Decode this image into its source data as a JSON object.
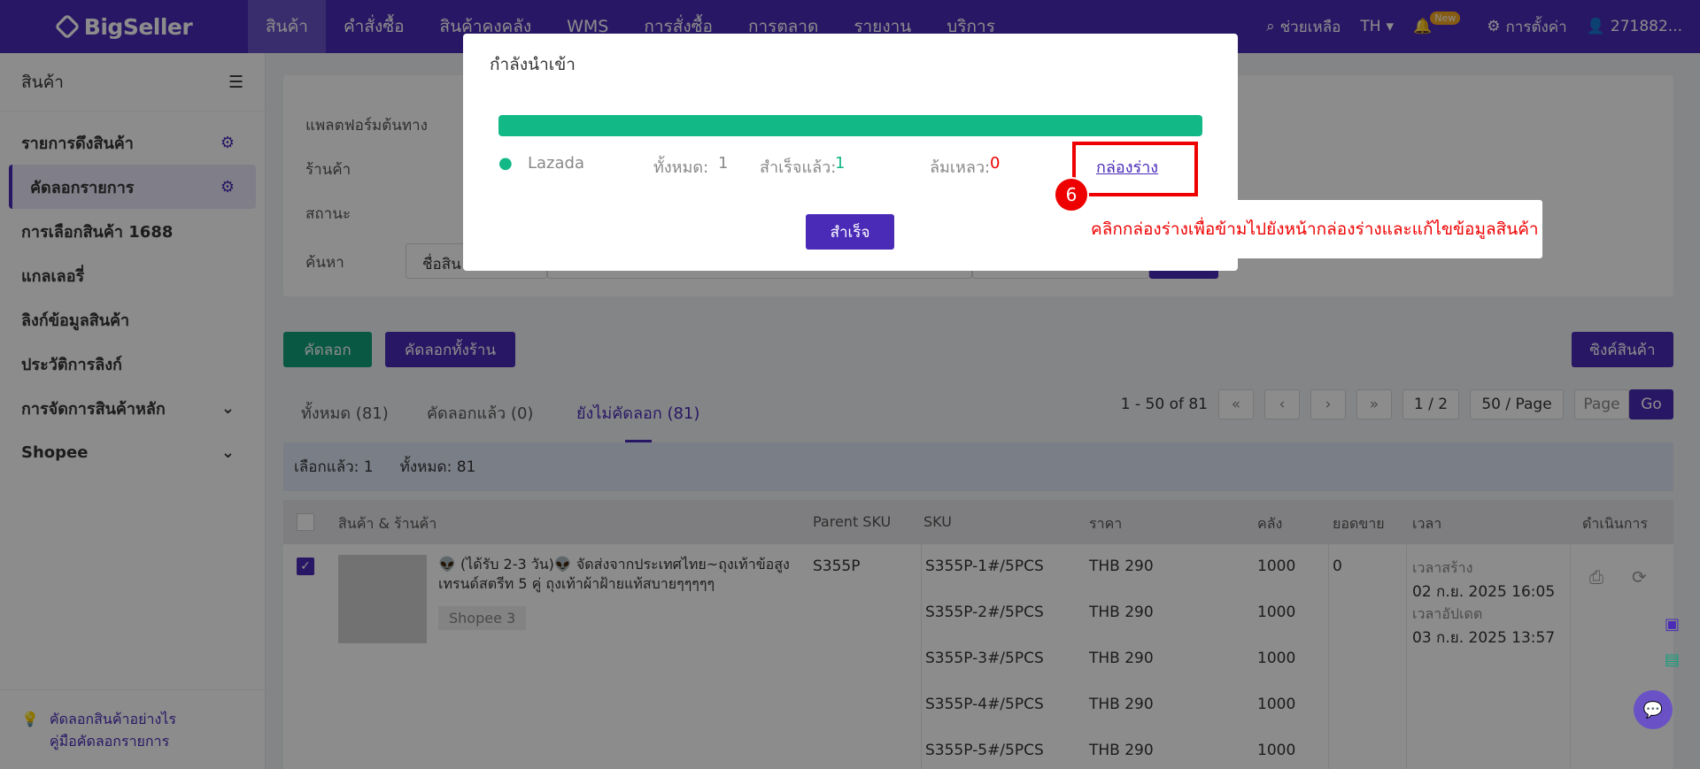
{
  "nav": {
    "logo": "BigSeller",
    "menu": [
      "สินค้า",
      "คำสั่งซื้อ",
      "สินค้าคงคลัง",
      "WMS",
      "การสั่งซื้อ",
      "การตลาด",
      "รายงาน",
      "บริการ"
    ],
    "help": "ช่วยเหลือ",
    "lang": "TH",
    "new_badge": "New",
    "settings": "การตั้งค่า",
    "user": "271882..."
  },
  "sidebar": {
    "title": "สินค้า",
    "items": [
      "รายการดึงสินค้า",
      "คัดลอกรายการ",
      "การเลือกสินค้า 1688",
      "แกลเลอรี่",
      "ลิงก์ข้อมูลสินค้า",
      "ประวัติการลิงก์",
      "การจัดการสินค้าหลัก",
      "Shopee"
    ],
    "footer_1": "คัดลอกสินค้าอย่างไร",
    "footer_2": "คู่มือคัดลอกรายการ"
  },
  "filter": {
    "platform_label": "แพลตฟอร์มต้นทาง",
    "store_label": "ร้านค้า",
    "status_label": "สถานะ",
    "search_label": "ค้นหา",
    "search_select": "ชื่อสิน"
  },
  "actions": {
    "copy": "คัดลอก",
    "copy_all": "คัดลอกทั้งร้าน",
    "sync": "ซิงค์สินค้า"
  },
  "tabs": [
    "ทั้งหมด (81)",
    "คัดลอกแล้ว (0)",
    "ยังไม่คัดลอก (81)"
  ],
  "pager": {
    "range": "1 - 50 of 81",
    "page": "1 / 2",
    "per_page": "50 / Page",
    "page_placeholder": "Page",
    "go": "Go"
  },
  "selection": {
    "selected": "เลือกแล้ว: 1",
    "total": "ทั้งหมด: 81"
  },
  "table": {
    "headers": [
      "สินค้า & ร้านค้า",
      "Parent SKU",
      "SKU",
      "ราคา",
      "คลัง",
      "ยอดขาย",
      "เวลา",
      "ดำเนินการ"
    ],
    "product_title": "👽 (ได้รับ 2-3 วัน)👽 จัดส่งจากประเทศไทย~ถุงเท้าข้อสูงเทรนด์สตรีท 5 คู่ ถุงเท้าผ้าฝ้ายแท้สบายๆๆๆๆๆ",
    "store": "Shopee 3",
    "parent_sku": "S355P",
    "skus": [
      "S355P-1#/5PCS",
      "S355P-2#/5PCS",
      "S355P-3#/5PCS",
      "S355P-4#/5PCS",
      "S355P-5#/5PCS"
    ],
    "prices": [
      "THB 290",
      "THB 290",
      "THB 290",
      "THB 290",
      "THB 290"
    ],
    "stocks": [
      "1000",
      "1000",
      "1000",
      "1000",
      "1000"
    ],
    "sales": "0",
    "created_label": "เวลาสร้าง",
    "created": "02 ก.ย. 2025 16:05",
    "updated_label": "เวลาอัปเดต",
    "updated": "03 ก.ย. 2025 13:57"
  },
  "modal": {
    "title": "กำลังนำเข้า",
    "progress_percent": 100,
    "platform": "Lazada",
    "total_label": "ทั้งหมด:",
    "total": "1",
    "success_label": "สำเร็จแล้ว:",
    "success": "1",
    "failed_label": "ล้มเหลว:",
    "failed": "0",
    "draft_link": "กล่องร่าง",
    "done_button": "สำเร็จ"
  },
  "annotation": {
    "step": "6",
    "text": "คลิกกล่องร่างเพื่อข้ามไปยังหน้ากล่องร่างและแก้ไขข้อมูลสินค้า"
  },
  "colors": {
    "brand": "#4a2bb8",
    "success": "#12b886",
    "danger": "#e00000"
  }
}
